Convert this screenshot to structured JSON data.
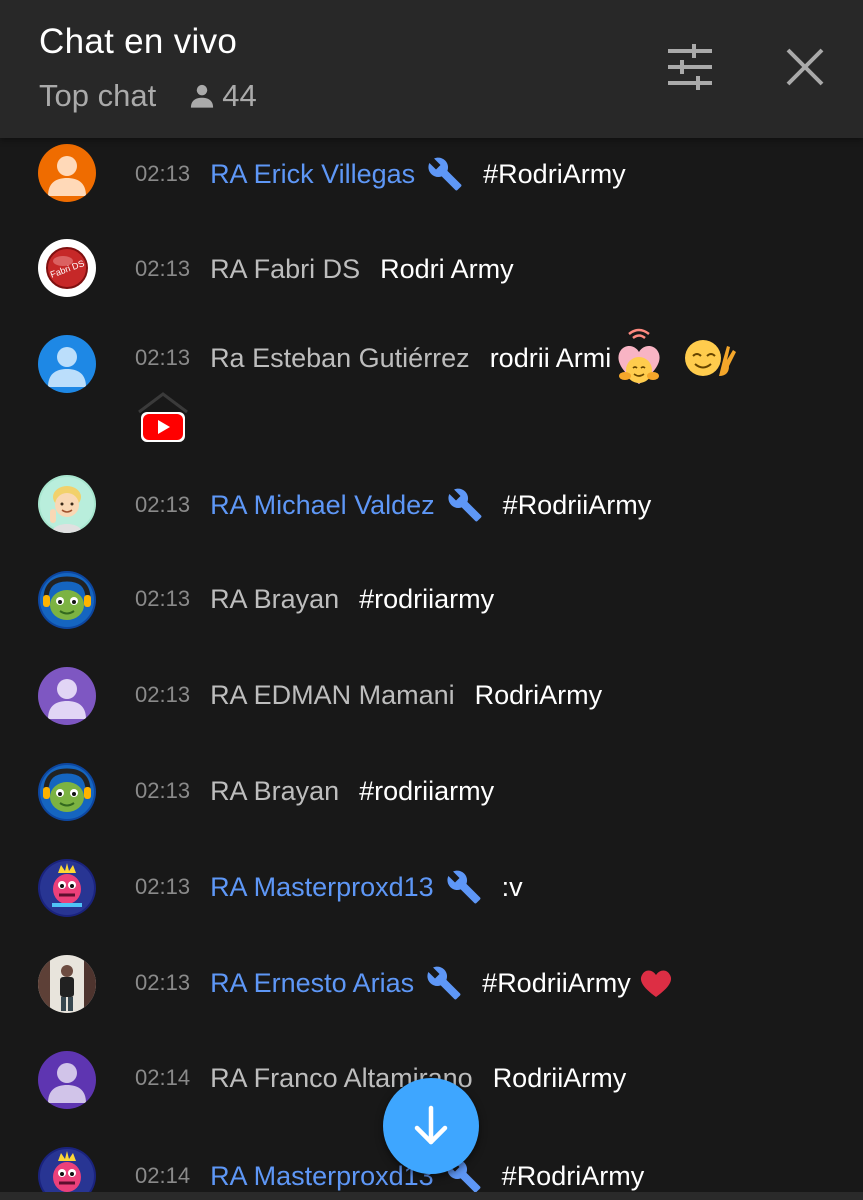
{
  "header": {
    "title": "Chat en vivo",
    "mode": "Top chat",
    "viewer_count": "44",
    "filter_icon": "tune-icon",
    "close_icon": "close-icon"
  },
  "colors": {
    "header_bg": "#282828",
    "body_bg": "#181818",
    "moderator": "#5e97f6",
    "author": "#bdbdbd",
    "accent": "#3ea6ff"
  },
  "messages": [
    {
      "time": "02:13",
      "author": "RA Erick Villegas",
      "moderator": true,
      "text": "#RodriArmy",
      "avatar": "orange-default-avatar"
    },
    {
      "time": "02:13",
      "author": "RA Fabri DS",
      "moderator": false,
      "text": "Rodri Army",
      "avatar": "red-button-avatar",
      "avatar_text": "Fabri DS"
    },
    {
      "time": "02:13",
      "author": "Ra Esteban Gutiérrez",
      "moderator": false,
      "text": "rodrii Armi",
      "avatar": "blue-default-avatar",
      "emojis": [
        "hugging-heart-emoji",
        "victory-hand-face-emoji",
        "youtube-emoji"
      ]
    },
    {
      "time": "02:13",
      "author": "RA Michael Valdez",
      "moderator": true,
      "text": "#RodriiArmy",
      "avatar": "memoji-avatar"
    },
    {
      "time": "02:13",
      "author": "RA Brayan",
      "moderator": false,
      "text": "#rodriiarmy",
      "avatar": "green-creature-avatar"
    },
    {
      "time": "02:13",
      "author": "RA EDMAN Mamani",
      "moderator": false,
      "text": "RodriArmy",
      "avatar": "purple-default-avatar"
    },
    {
      "time": "02:13",
      "author": "RA Brayan",
      "moderator": false,
      "text": "#rodriiarmy",
      "avatar": "green-creature-avatar"
    },
    {
      "time": "02:13",
      "author": "RA Masterproxd13",
      "moderator": true,
      "text": ":v",
      "avatar": "king-character-avatar"
    },
    {
      "time": "02:13",
      "author": "RA Ernesto Arias",
      "moderator": true,
      "text": "#RodriiArmy",
      "avatar": "photo-avatar",
      "emojis": [
        "red-heart-emoji"
      ]
    },
    {
      "time": "02:14",
      "author": "RA Franco Altamirano",
      "moderator": false,
      "text": "RodriiArmy",
      "avatar": "indigo-default-avatar"
    },
    {
      "time": "02:14",
      "author": "RA Masterproxd13",
      "moderator": true,
      "text": "#RodriArmy",
      "avatar": "king-character-avatar"
    }
  ],
  "scroll_button": {
    "icon": "arrow-down-icon"
  }
}
